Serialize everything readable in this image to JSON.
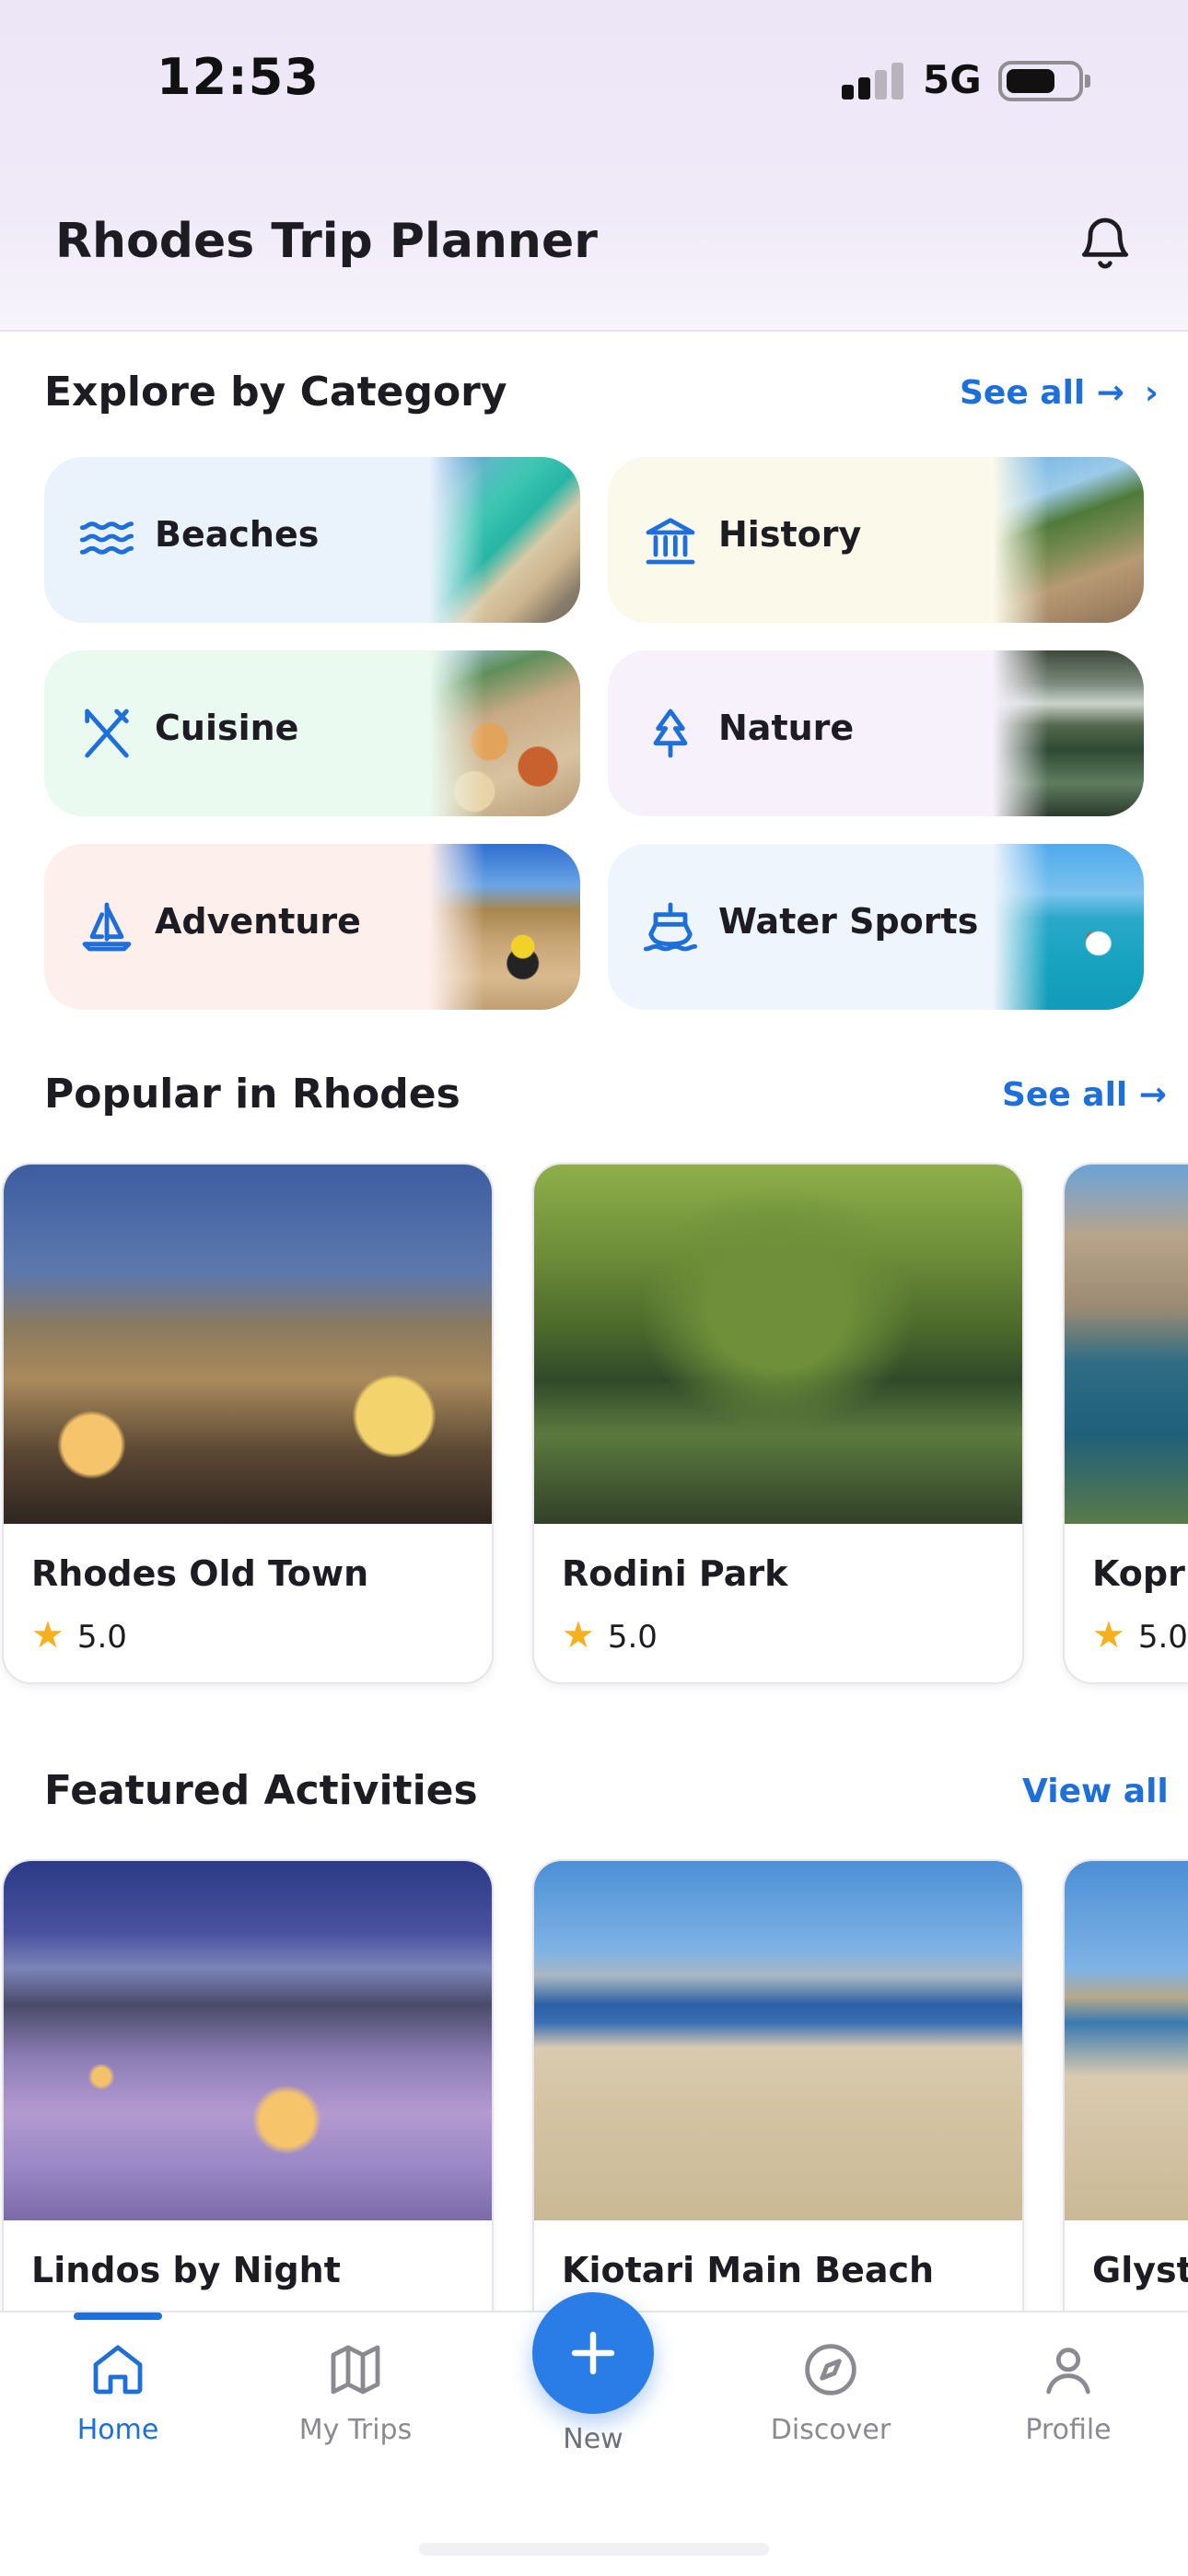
{
  "status_bar": {
    "time": "12:53",
    "network": "5G",
    "battery_level": 0.7
  },
  "header": {
    "title": "Rhodes Trip Planner",
    "bell_icon": "bell-icon"
  },
  "categories_section": {
    "title": "Explore by Category",
    "link": "See all →",
    "chevron": "›",
    "items": [
      {
        "label": "Beaches",
        "icon": "waves-icon",
        "bg": "#eaf3fc"
      },
      {
        "label": "History",
        "icon": "landmark-icon",
        "bg": "#fbfaea"
      },
      {
        "label": "Cuisine",
        "icon": "utensils-icon",
        "bg": "#eafaf0"
      },
      {
        "label": "Nature",
        "icon": "tree-icon",
        "bg": "#f6f1fa"
      },
      {
        "label": "Adventure",
        "icon": "sailboat-icon",
        "bg": "#fdefec"
      },
      {
        "label": "Water Sports",
        "icon": "ship-icon",
        "bg": "#eef5fc"
      }
    ]
  },
  "popular_section": {
    "title": "Popular in Rhodes",
    "link": "See all →",
    "cards": [
      {
        "name": "Rhodes Old Town",
        "rating": "5.0"
      },
      {
        "name": "Rodini Park",
        "rating": "5.0"
      },
      {
        "name": "Kopria",
        "rating": "5.0"
      }
    ]
  },
  "featured_section": {
    "title": "Featured Activities",
    "link": "View all",
    "cards": [
      {
        "name": "Lindos by Night"
      },
      {
        "name": "Kiotari Main Beach"
      },
      {
        "name": "Glystr"
      }
    ]
  },
  "bottom_nav": {
    "items": [
      {
        "label": "Home",
        "icon": "home-icon",
        "active": true
      },
      {
        "label": "My Trips",
        "icon": "map-icon",
        "active": false
      },
      {
        "label": "New",
        "icon": "plus-icon",
        "active": false
      },
      {
        "label": "Discover",
        "icon": "compass-icon",
        "active": false
      },
      {
        "label": "Profile",
        "icon": "user-icon",
        "active": false
      }
    ]
  },
  "colors": {
    "accent": "#1e6fd9",
    "star": "#f6b01e"
  }
}
